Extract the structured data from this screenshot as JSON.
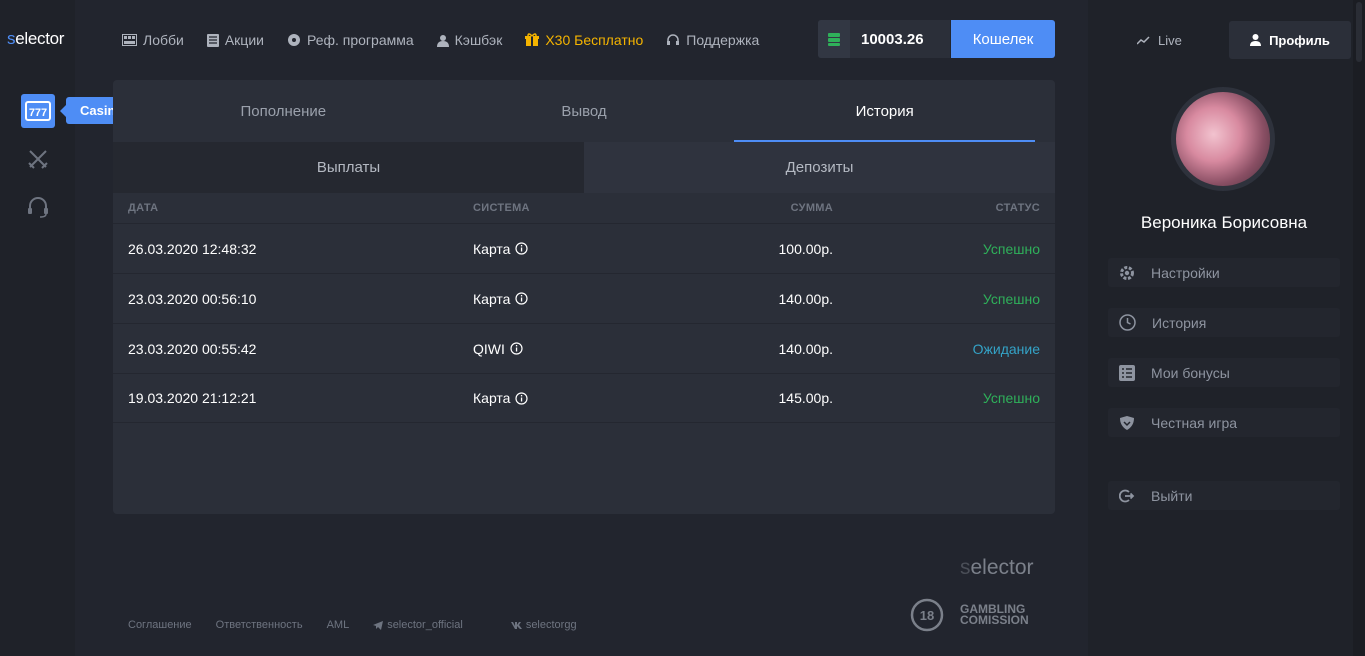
{
  "brand": {
    "logo_first": "s",
    "logo_rest": "elector"
  },
  "rail": {
    "tooltip": "Casino"
  },
  "nav": [
    {
      "label": "Лобби",
      "icon": "lobby-icon"
    },
    {
      "label": "Акции",
      "icon": "promotions-icon"
    },
    {
      "label": "Реф. программа",
      "icon": "referral-icon"
    },
    {
      "label": "Кэшбэк",
      "icon": "cashback-icon"
    },
    {
      "label": "X30 Бесплатно",
      "icon": "gift-icon"
    },
    {
      "label": "Поддержка",
      "icon": "support-icon"
    }
  ],
  "balance": {
    "value": "10003.26",
    "wallet_label": "Кошелек"
  },
  "tabs": [
    "Пополнение",
    "Вывод",
    "История"
  ],
  "subtabs": [
    "Выплаты",
    "Депозиты"
  ],
  "table": {
    "headers": {
      "date": "ДАТА",
      "system": "СИСТЕМА",
      "amount": "СУММА",
      "status": "СТАТУС"
    },
    "rows": [
      {
        "date": "26.03.2020 12:48:32",
        "system": "Карта",
        "amount": "100.00р.",
        "status": "Успешно"
      },
      {
        "date": "23.03.2020 00:56:10",
        "system": "Карта",
        "amount": "140.00р.",
        "status": "Успешно"
      },
      {
        "date": "23.03.2020 00:55:42",
        "system": "QIWI",
        "amount": "140.00р.",
        "status": "Ожидание"
      },
      {
        "date": "19.03.2020 21:12:21",
        "system": "Карта",
        "amount": "145.00р.",
        "status": "Успешно"
      }
    ]
  },
  "footer": {
    "links": [
      "Соглашение",
      "Ответственность",
      "AML",
      "selector_official",
      "selectorgg"
    ],
    "age": "18",
    "gambling_line1": "GAMBLING",
    "gambling_line2": "COMISSION"
  },
  "sidebar": {
    "live_label": "Live",
    "profile_label": "Профиль",
    "username": "Вероника Борисовна",
    "menu": [
      "Настройки",
      "История",
      "Мои бонусы",
      "Честная игра",
      "Выйти"
    ]
  },
  "colors": {
    "accent": "#4e8df5",
    "success": "#2fb05a",
    "pending": "#34a3c7",
    "promo": "#f5b400"
  }
}
